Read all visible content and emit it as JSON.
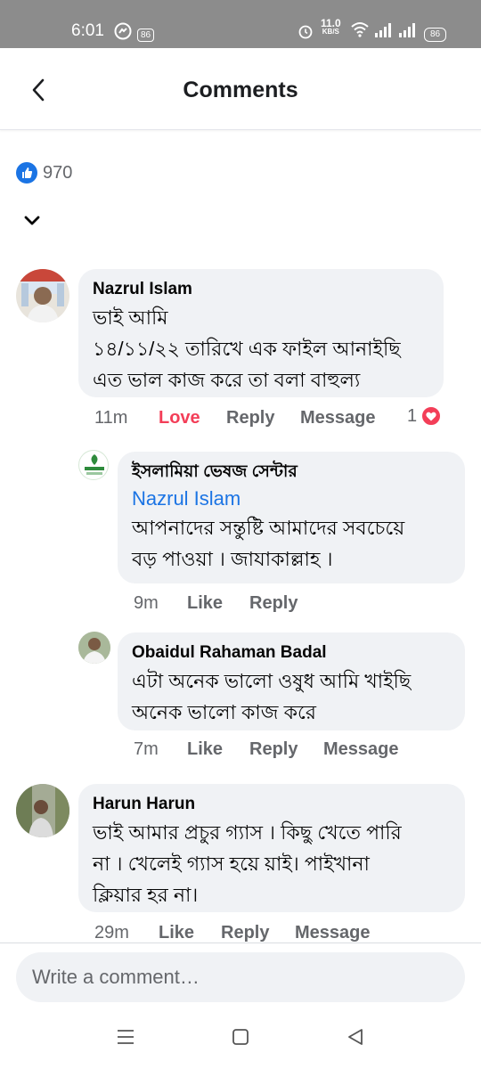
{
  "status_bar": {
    "time": "6:01",
    "notif_badge": "86",
    "speed_top": "11.0",
    "speed_unit": "KB/S",
    "battery": "86"
  },
  "header": {
    "title": "Comments"
  },
  "reactions": {
    "count": "970"
  },
  "comments": [
    {
      "author": "Nazrul Islam",
      "lines": [
        "ভাই আমি",
        "১৪/১১/২২ তারিখে এক ফাইল আনাইছি",
        "এত ভাল কাজ করে তা বলা বাহুল্য"
      ],
      "time": "11m",
      "reaction_label": "Love",
      "reply": "Reply",
      "message": "Message",
      "reaction_count": "1"
    },
    {
      "author": "ইসলামিয়া ভেষজ সেন্টার",
      "mention": "Nazrul Islam",
      "lines": [
        "আপনাদের সন্তুষ্টি আমাদের সবচেয়ে",
        "বড় পাওয়া । জাযাকাল্লাহ ।"
      ],
      "time": "9m",
      "like": "Like",
      "reply": "Reply"
    },
    {
      "author": "Obaidul Rahaman Badal",
      "lines": [
        "এটা অনেক ভালো ওষুধ আমি খাইছি",
        "অনেক ভালো কাজ করে"
      ],
      "time": "7m",
      "like": "Like",
      "reply": "Reply",
      "message": "Message"
    },
    {
      "author": "Harun Harun",
      "lines": [
        "ভাই আমার প্রচুর  গ্যাস । কিছু খেতে পারি",
        "না । খেলেই গ্যাস  হয়ে য়াই। পাইখানা",
        "ক্লিয়ার  হর না।"
      ],
      "time": "29m",
      "like": "Like",
      "reply": "Reply",
      "message": "Message"
    }
  ],
  "composer": {
    "placeholder": "Write a comment…"
  },
  "colors": {
    "accent": "#1b74e4",
    "love": "#f33e58",
    "bubble": "#f0f2f5",
    "muted": "#65676b"
  }
}
